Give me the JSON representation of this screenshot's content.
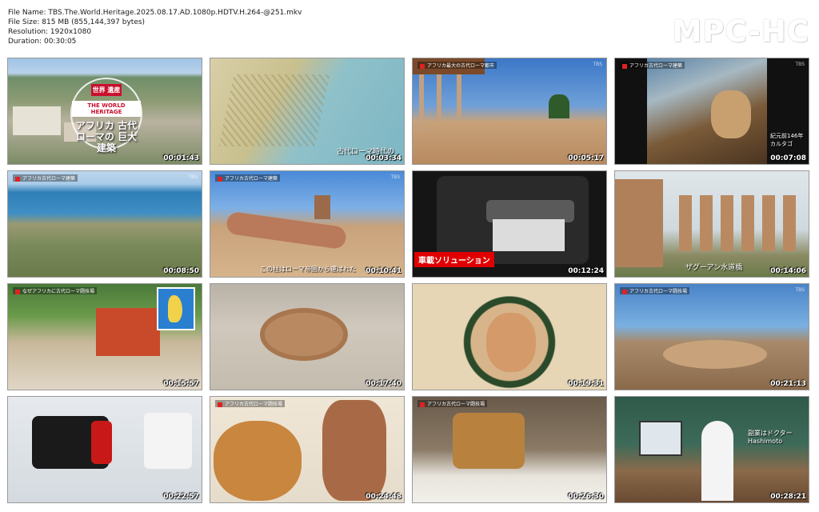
{
  "info": {
    "file_name": "File Name: TBS.The.World.Heritage.2025.08.17.AD.1080p.HDTV.H.264-@251.mkv",
    "file_size": "File Size: 815 MB (855,144,397 bytes)",
    "resolution": "Resolution: 1920x1080",
    "duration": "Duration: 00:30:05"
  },
  "logo": "MPC-HC",
  "thumbnails": [
    {
      "time": "00:01:43",
      "title_badge1": "世界 遺産",
      "title_badge2": "THE WORLD HERITAGE",
      "title_text": "アフリカ 古代ローマの 巨大建築"
    },
    {
      "time": "00:03:34",
      "caption": "古代ローマ時代の"
    },
    {
      "time": "00:05:17",
      "tag": "アフリカ最大の古代ローマ都市"
    },
    {
      "time": "00:07:08",
      "tag": "アフリカ古代ローマ建築",
      "caption": "紀元前146年 カルタゴ"
    },
    {
      "time": "00:08:50",
      "tag": "アフリカ古代ローマ建築"
    },
    {
      "time": "00:10:41",
      "tag": "アフリカ古代ローマ建築",
      "caption": "この柱はローマ帝国から運ばれた"
    },
    {
      "time": "00:12:24",
      "banner": "車載ソリューション"
    },
    {
      "time": "00:14:06",
      "caption": "ザグーアン水道橋"
    },
    {
      "time": "00:15:57",
      "tag": "なぜアフリカに古代ローマ闘技場"
    },
    {
      "time": "00:17:40"
    },
    {
      "time": "00:19:31"
    },
    {
      "time": "00:21:13",
      "tag": "アフリカ古代ローマ闘技場"
    },
    {
      "time": "00:22:57"
    },
    {
      "time": "00:24:48",
      "tag": "アフリカ古代ローマ闘技場"
    },
    {
      "time": "00:26:30",
      "tag": "アフリカ古代ローマ闘技場"
    },
    {
      "time": "00:28:21",
      "caption": "副業はドクター Hashimoto"
    }
  ]
}
